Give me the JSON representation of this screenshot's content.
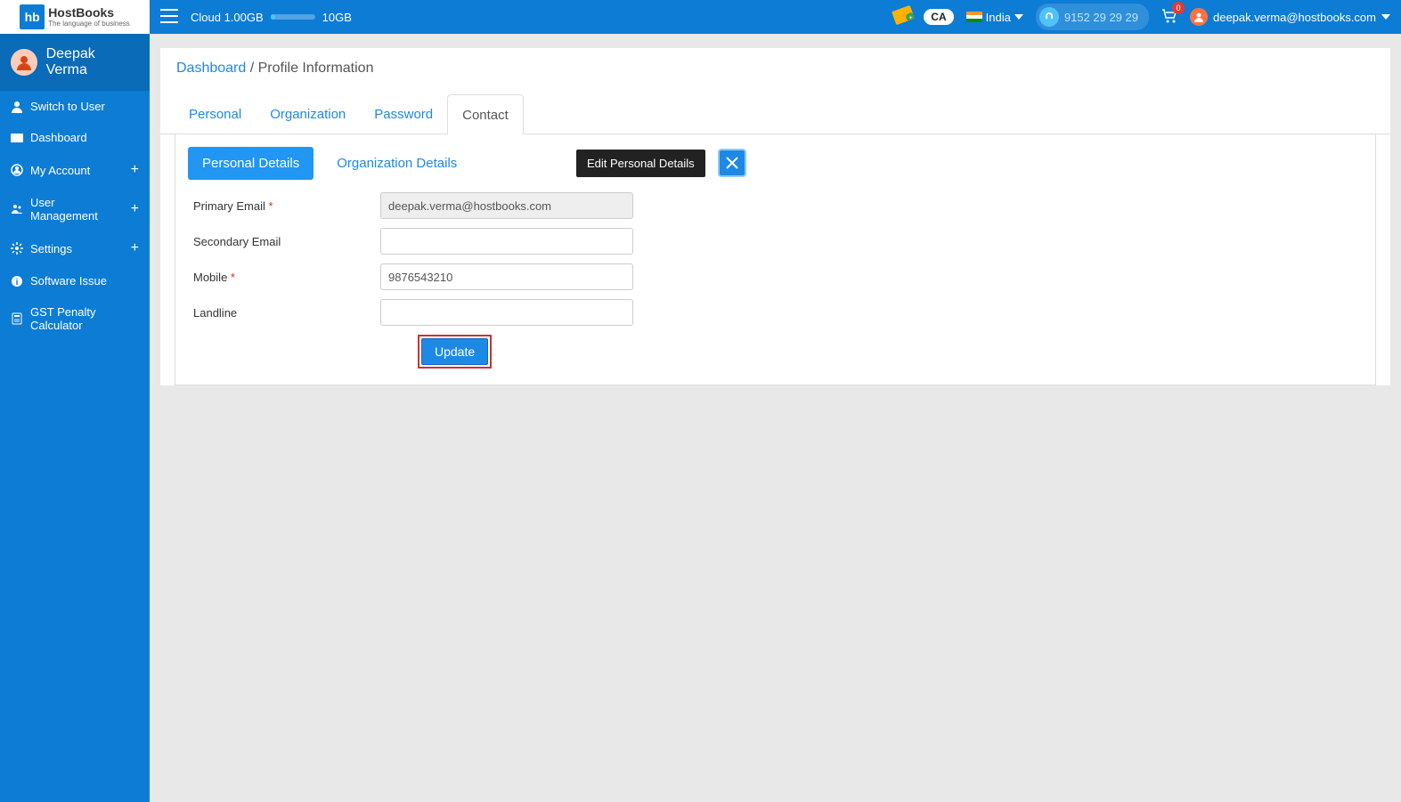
{
  "brand": {
    "hb": "hb",
    "name": "HostBooks",
    "tag": "The language of business"
  },
  "header": {
    "cloud_label": "Cloud 1.00GB",
    "cloud_max": "10GB",
    "ca": "CA",
    "country": "India",
    "support_phone": "9152 29 29 29",
    "cart_count": "0",
    "user_email": "deepak.verma@hostbooks.com"
  },
  "sidebar": {
    "user_name": "Deepak Verma",
    "items": [
      {
        "label": "Switch to User",
        "icon": "user-icon",
        "plus": false
      },
      {
        "label": "Dashboard",
        "icon": "dashboard-icon",
        "plus": false
      },
      {
        "label": "My Account",
        "icon": "account-icon",
        "plus": true
      },
      {
        "label": "User Management",
        "icon": "users-icon",
        "plus": true
      },
      {
        "label": "Settings",
        "icon": "gear-icon",
        "plus": true
      },
      {
        "label": "Software Issue",
        "icon": "info-icon",
        "plus": false
      },
      {
        "label": "GST Penalty Calculator",
        "icon": "calculator-icon",
        "plus": false
      }
    ]
  },
  "breadcrumb": {
    "root": "Dashboard",
    "sep": " / ",
    "current": "Profile Information"
  },
  "tabs": {
    "personal": "Personal",
    "organization": "Organization",
    "password": "Password",
    "contact": "Contact"
  },
  "subtabs": {
    "personal_details": "Personal Details",
    "organization_details": "Organization Details"
  },
  "tooltip": "Edit Personal Details",
  "form": {
    "primary_email_label": "Primary Email",
    "primary_email_value": "deepak.verma@hostbooks.com",
    "secondary_email_label": "Secondary Email",
    "secondary_email_value": "",
    "mobile_label": "Mobile",
    "mobile_value": "9876543210",
    "landline_label": "Landline",
    "landline_value": "",
    "update": "Update"
  }
}
